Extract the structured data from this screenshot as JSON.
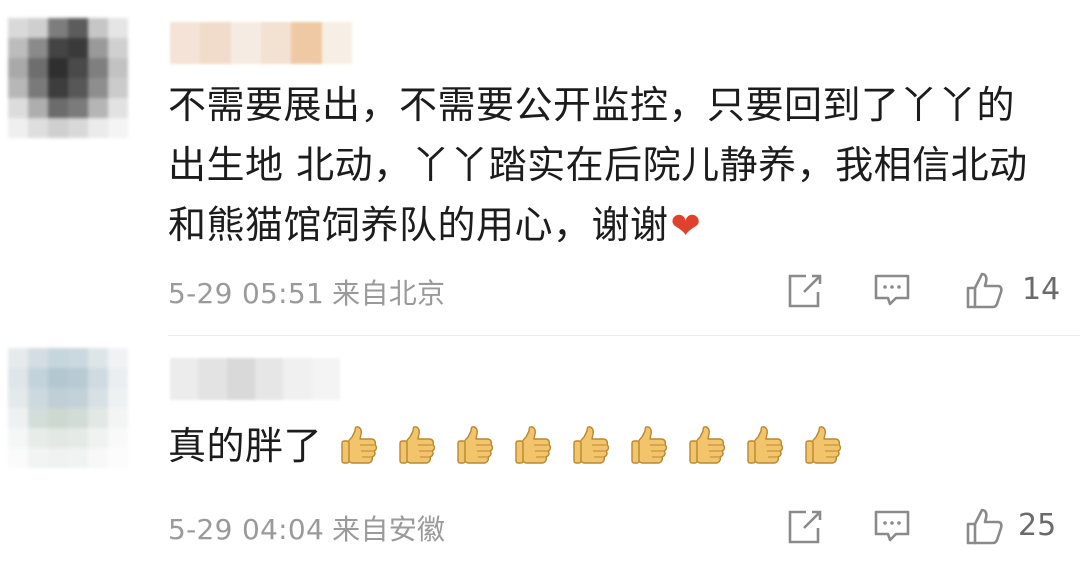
{
  "comments": [
    {
      "text": "不需要展出，不需要公开监控，只要回到了丫丫的出生地 北动，丫丫踏实在后院儿静养，我相信北动和熊猫馆饲养队的用心，谢谢",
      "emoji": "❤",
      "date": "5-29 05:51",
      "location": "来自北京",
      "likes": "14",
      "avatar_colors": [
        "#d9d9d9",
        "#cfcfcf",
        "#7d7d7d",
        "#5c5c5c",
        "#c6c6c6",
        "#e5e5e5",
        "#bcbcbc",
        "#8a8a8a",
        "#444444",
        "#3a3a3a",
        "#9a9a9a",
        "#d0d0d0",
        "#a9a9a9",
        "#6e6e6e",
        "#2f2f2f",
        "#4a4a4a",
        "#7f7f7f",
        "#c2c2c2",
        "#b7b7b7",
        "#7a7a7a",
        "#3d3d3d",
        "#575757",
        "#8e8e8e",
        "#cbcbcb",
        "#dcdcdc",
        "#aeaeae",
        "#6c6c6c",
        "#7b7b7b",
        "#b5b5b5",
        "#e2e2e2",
        "#efefef",
        "#dedede",
        "#cfcfcf",
        "#d8d8d8",
        "#ebebeb",
        "#f4f4f4"
      ],
      "name_colors": [
        "#f4e3d6",
        "#f1dccb",
        "#f6ebe3",
        "#f3e1d2",
        "#efc9a3",
        "#f7eee6"
      ]
    },
    {
      "text": "真的胖了",
      "thumbs_count": 9,
      "date": "5-29 04:04",
      "location": "来自安徽",
      "likes": "25",
      "avatar_colors": [
        "#e6eaec",
        "#d4dde2",
        "#c6d6dd",
        "#cad8df",
        "#dde5e9",
        "#f0f3f4",
        "#dfe5e8",
        "#c3d3db",
        "#b3c7d1",
        "#b8cbd3",
        "#cfdbe1",
        "#eaeef0",
        "#e4e9eb",
        "#ccd9df",
        "#c0cfd6",
        "#c3d1d8",
        "#d7e0e4",
        "#eef1f2",
        "#eef1f2",
        "#d3ddd9",
        "#cdd8d0",
        "#d2dcd6",
        "#e2e8e5",
        "#f3f5f4",
        "#f5f7f6",
        "#e8ece9",
        "#e2e8e3",
        "#e5eae7",
        "#eff2f0",
        "#f8f9f8",
        "#fafbfa",
        "#f2f4f3",
        "#eff2f0",
        "#f1f3f2",
        "#f7f8f7",
        "#fcfcfc"
      ],
      "name_colors": [
        "#ececec",
        "#e3e3e3",
        "#d9d9d9",
        "#e6e6e6",
        "#f0f0f0",
        "#f4f4f4"
      ]
    }
  ],
  "icons": {
    "share": "share-icon",
    "reply": "comment-icon",
    "like": "thumbs-up-icon",
    "heart": "red-heart-emoji",
    "thumb": "thumbs-up-emoji"
  },
  "colors": {
    "text": "#1c1c1c",
    "meta": "#9a9a9a",
    "heart": "#e0412f",
    "thumb_fill": "#f2c56c"
  }
}
